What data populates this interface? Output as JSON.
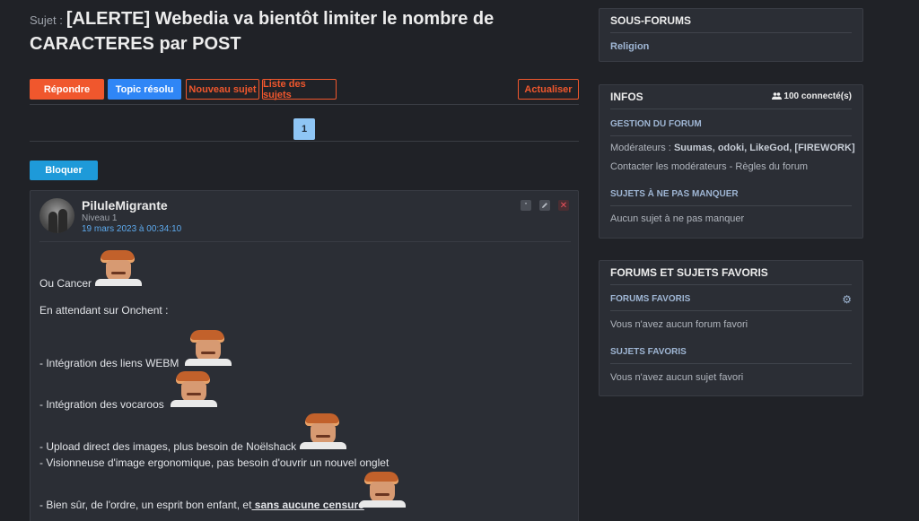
{
  "topic": {
    "prefix": "Sujet :",
    "title_line1": "[ALERTE] Webedia va bientôt limiter le nombre de",
    "title_line2": "CARACTERES par POST"
  },
  "actions": {
    "reply": "Répondre",
    "resolved": "Topic résolu",
    "new_topic": "Nouveau sujet",
    "topic_list": "Liste des sujets",
    "refresh": "Actualiser",
    "block": "Bloquer"
  },
  "pagination": {
    "current": "1"
  },
  "post": {
    "author": "PiluleMigrante",
    "level": "Niveau 1",
    "date": "19 mars 2023 à 00:34:10",
    "quote_icon": "”",
    "lines": {
      "l1": "Ou Cancer",
      "l2": "En attendant sur Onchent :",
      "l3": "- Intégration des liens WEBM",
      "l4": "- Intégration des vocaroos",
      "l5": "- Upload direct des images, plus besoin de Noëlshack",
      "l6": "- Visionneuse d'image ergonomique, pas besoin d'ouvrir un nouvel onglet",
      "l7_prefix": "- Bien sûr, de l'ordre, un esprit bon enfant, et",
      "l7_bold": " sans aucune censure "
    }
  },
  "sidebar": {
    "subforums": {
      "title": "SOUS-FORUMS",
      "item": "Religion"
    },
    "infos": {
      "title": "INFOS",
      "online": "100 connecté(s)",
      "manage_title": "GESTION DU FORUM",
      "mods_label": "Modérateurs :",
      "mods_names": "Suumas, odoki, LikeGod, [FIREWORK]",
      "contact": "Contacter les modérateurs - Règles du forum",
      "must_title": "SUJETS À NE PAS MANQUER",
      "must_text": "Aucun sujet à ne pas manquer"
    },
    "favorites": {
      "title": "FORUMS ET SUJETS FAVORIS",
      "forums_title": "FORUMS FAVORIS",
      "forums_text": "Vous n'avez aucun forum favori",
      "topics_title": "SUJETS FAVORIS",
      "topics_text": "Vous n'avez aucun sujet favori"
    }
  },
  "colors": {
    "background": "#202227",
    "accent_orange": "#f0572d",
    "accent_blue": "#2f86f6",
    "block_blue": "#1e9ad9",
    "link_blue": "#5da9ec"
  },
  "icons": [
    "quote-icon",
    "edit-icon",
    "delete-icon",
    "users-icon",
    "gear-icon"
  ]
}
